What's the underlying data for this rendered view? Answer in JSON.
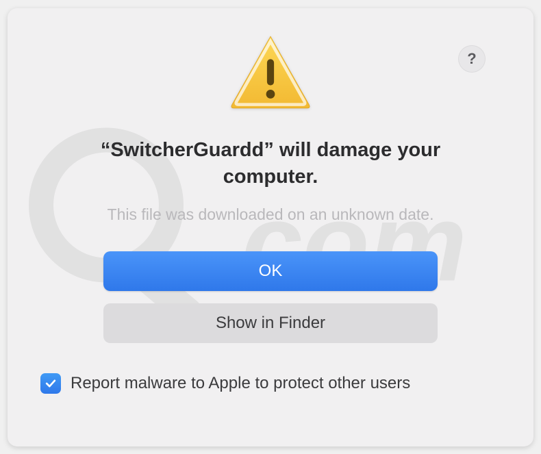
{
  "dialog": {
    "app_name": "SwitcherGuardd",
    "title_prefix": "“",
    "title_suffix": "” will damage your computer.",
    "subtitle": "This file was downloaded on an unknown date.",
    "help_glyph": "?"
  },
  "buttons": {
    "ok": "OK",
    "show_in_finder": "Show in Finder"
  },
  "checkbox": {
    "label": "Report malware to Apple to protect other users",
    "checked": true
  },
  "colors": {
    "primary_blue": "#2f78ea",
    "dialog_bg": "#f1f0f1",
    "secondary_button": "#dcdbdd",
    "muted_text": "#b9b8bb"
  }
}
